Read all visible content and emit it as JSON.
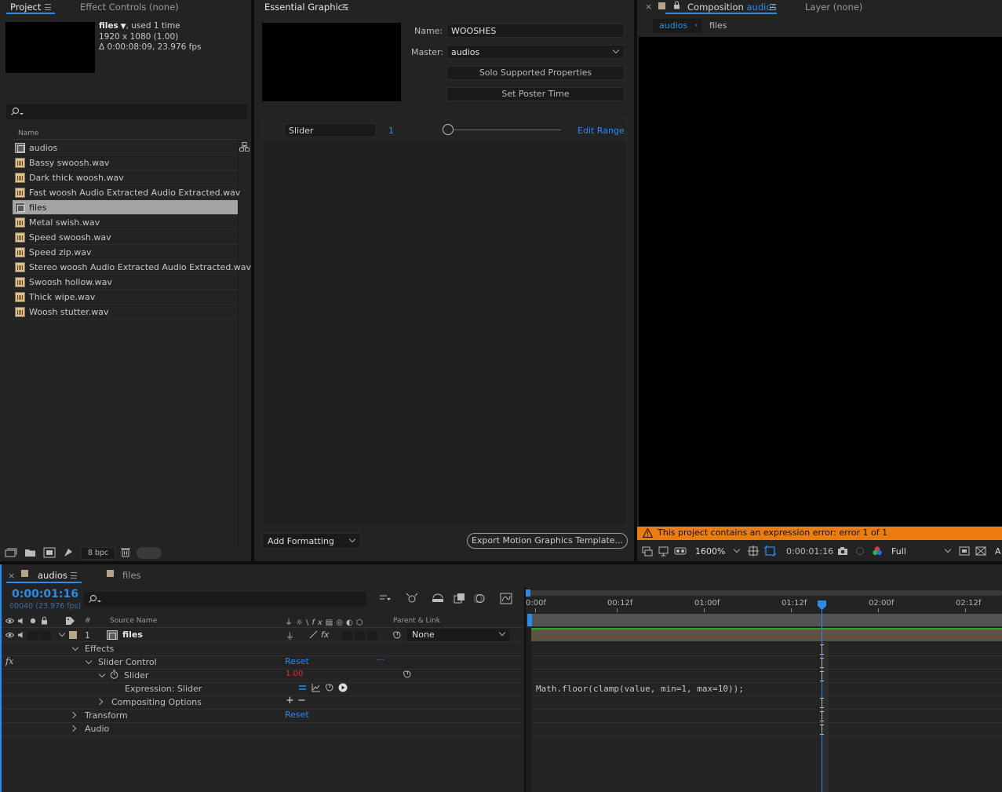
{
  "project_panel": {
    "tabs": [
      {
        "label": "Project",
        "active": true
      },
      {
        "label": "Effect Controls (none)",
        "active": false
      }
    ],
    "selected_item": {
      "name": "files",
      "usage": ", used 1 time",
      "dimensions": "1920 x 1080 (1.00)",
      "duration": "Δ 0:00:08:09, 23.976 fps"
    },
    "search_placeholder": "",
    "column_name": "Name",
    "items": [
      {
        "name": "audios",
        "type": "comp",
        "selected": false
      },
      {
        "name": "Bassy swoosh.wav",
        "type": "wav",
        "selected": false
      },
      {
        "name": "Dark thick woosh.wav",
        "type": "wav",
        "selected": false
      },
      {
        "name": "Fast woosh Audio Extracted Audio Extracted.wav",
        "type": "wav",
        "selected": false
      },
      {
        "name": "files",
        "type": "comp",
        "selected": true
      },
      {
        "name": "Metal swish.wav",
        "type": "wav",
        "selected": false
      },
      {
        "name": "Speed swoosh.wav",
        "type": "wav",
        "selected": false
      },
      {
        "name": "Speed zip.wav",
        "type": "wav",
        "selected": false
      },
      {
        "name": "Stereo woosh Audio Extracted Audio Extracted.wav",
        "type": "wav",
        "selected": false
      },
      {
        "name": "Swoosh hollow.wav",
        "type": "wav",
        "selected": false
      },
      {
        "name": "Thick wipe.wav",
        "type": "wav",
        "selected": false
      },
      {
        "name": "Woosh stutter.wav",
        "type": "wav",
        "selected": false
      }
    ],
    "bpc": "8 bpc"
  },
  "essential_graphics": {
    "title": "Essential Graphics",
    "name_label": "Name:",
    "name_value": "WOOSHES",
    "master_label": "Master:",
    "master_value": "audios",
    "solo_button": "Solo Supported Properties",
    "poster_button": "Set Poster Time",
    "slider_name": "Slider",
    "slider_value": "1",
    "edit_range": "Edit Range",
    "add_formatting": "Add Formatting",
    "export_button": "Export Motion Graphics Template..."
  },
  "composition_panel": {
    "tab_prefix": "Composition",
    "tab_comp": "audios",
    "layer_tab": "Layer (none)",
    "breadcrumb": [
      "audios",
      "files"
    ],
    "error_message": "This project contains an expression error: error 1 of 1",
    "zoom": "1600%",
    "timecode": "0:00:01:16",
    "resolution": "Full",
    "trailing": "A"
  },
  "timeline": {
    "tabs": [
      {
        "label": "audios",
        "active": true
      },
      {
        "label": "files",
        "active": false
      }
    ],
    "timecode": "0:00:01:16",
    "frames_fps": "00040 (23.976 fps)",
    "col_num": "#",
    "col_source": "Source Name",
    "col_parent": "Parent & Link",
    "layer_num": "1",
    "layer_name": "files",
    "parent_value": "None",
    "effects_label": "Effects",
    "slider_control_label": "Slider Control",
    "reset_label": "Reset",
    "dots": "....",
    "slider_label": "Slider",
    "slider_value": "1.00",
    "expression_label": "Expression: Slider",
    "compositing_label": "Compositing Options",
    "plus_minus": "+ −",
    "transform_label": "Transform",
    "transform_reset": "Reset",
    "audio_label": "Audio",
    "fx_label": "fx",
    "expression_code": "Math.floor(clamp(value, min=1, max=10));",
    "ruler": [
      "0:00f",
      "00:12f",
      "01:00f",
      "01:12f",
      "02:00f",
      "02:12f"
    ]
  }
}
